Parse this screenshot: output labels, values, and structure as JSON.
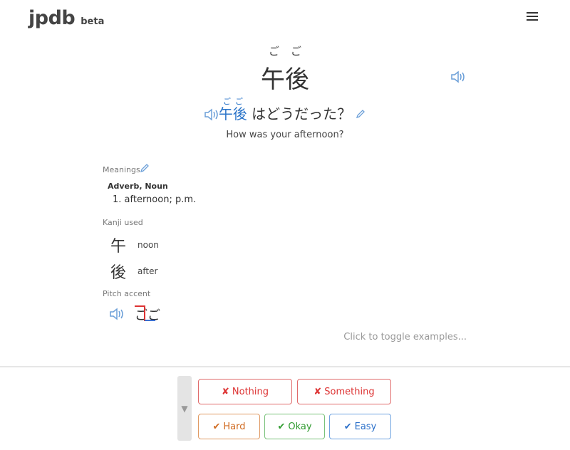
{
  "header": {
    "logo": "jpdb",
    "beta": "beta",
    "menu_icon": "hamburger-menu-icon"
  },
  "vocab": {
    "furigana": "ごご",
    "word": "午後"
  },
  "example": {
    "word_furigana": "ごご",
    "word": "午後",
    "rest": "はどうだった？",
    "translation": "How was your afternoon?"
  },
  "meanings": {
    "label": "Meanings",
    "part_of_speech": "Adverb,  Noun",
    "items": [
      "1. afternoon; p.m."
    ]
  },
  "kanji_used": {
    "label": "Kanji used",
    "items": [
      {
        "kanji": "午",
        "meaning": "noon"
      },
      {
        "kanji": "後",
        "meaning": "after"
      }
    ]
  },
  "pitch_accent": {
    "label": "Pitch accent",
    "reading": "ごご"
  },
  "toggle_examples": "Click to toggle examples...",
  "grading": {
    "nothing": "Nothing",
    "something": "Something",
    "hard": "Hard",
    "okay": "Okay",
    "easy": "Easy",
    "fail_mark": "✘",
    "pass_mark": "✔",
    "collapse_glyph": "▼"
  },
  "colors": {
    "accent_blue": "#2a74c9",
    "fail_red": "#d33333",
    "hard_orange": "#d06a20",
    "okay_green": "#2f9b2f",
    "easy_blue": "#2a6fc9"
  }
}
